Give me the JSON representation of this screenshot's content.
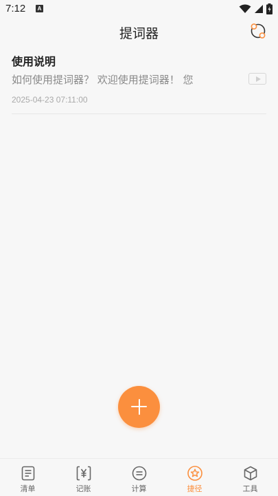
{
  "status_bar": {
    "time": "7:12",
    "notification_letter": "A"
  },
  "header": {
    "title": "提词器",
    "sync_icon": "sync-icon"
  },
  "notes": [
    {
      "title": "使用说明",
      "preview": "如何使用提词器？ 欢迎使用提词器！ 您",
      "date": "2025-04-23 07:11:00"
    }
  ],
  "fab": {
    "icon": "plus-icon"
  },
  "tabs": [
    {
      "label": "清单",
      "icon": "list-icon",
      "active": false
    },
    {
      "label": "记账",
      "icon": "yuan-icon",
      "active": false
    },
    {
      "label": "计算",
      "icon": "equals-icon",
      "active": false
    },
    {
      "label": "捷径",
      "icon": "star-icon",
      "active": true
    },
    {
      "label": "工具",
      "icon": "cube-icon",
      "active": false
    }
  ],
  "colors": {
    "accent": "#fb8f3e",
    "background": "#f7f7f7",
    "tab_inactive": "#666666"
  }
}
